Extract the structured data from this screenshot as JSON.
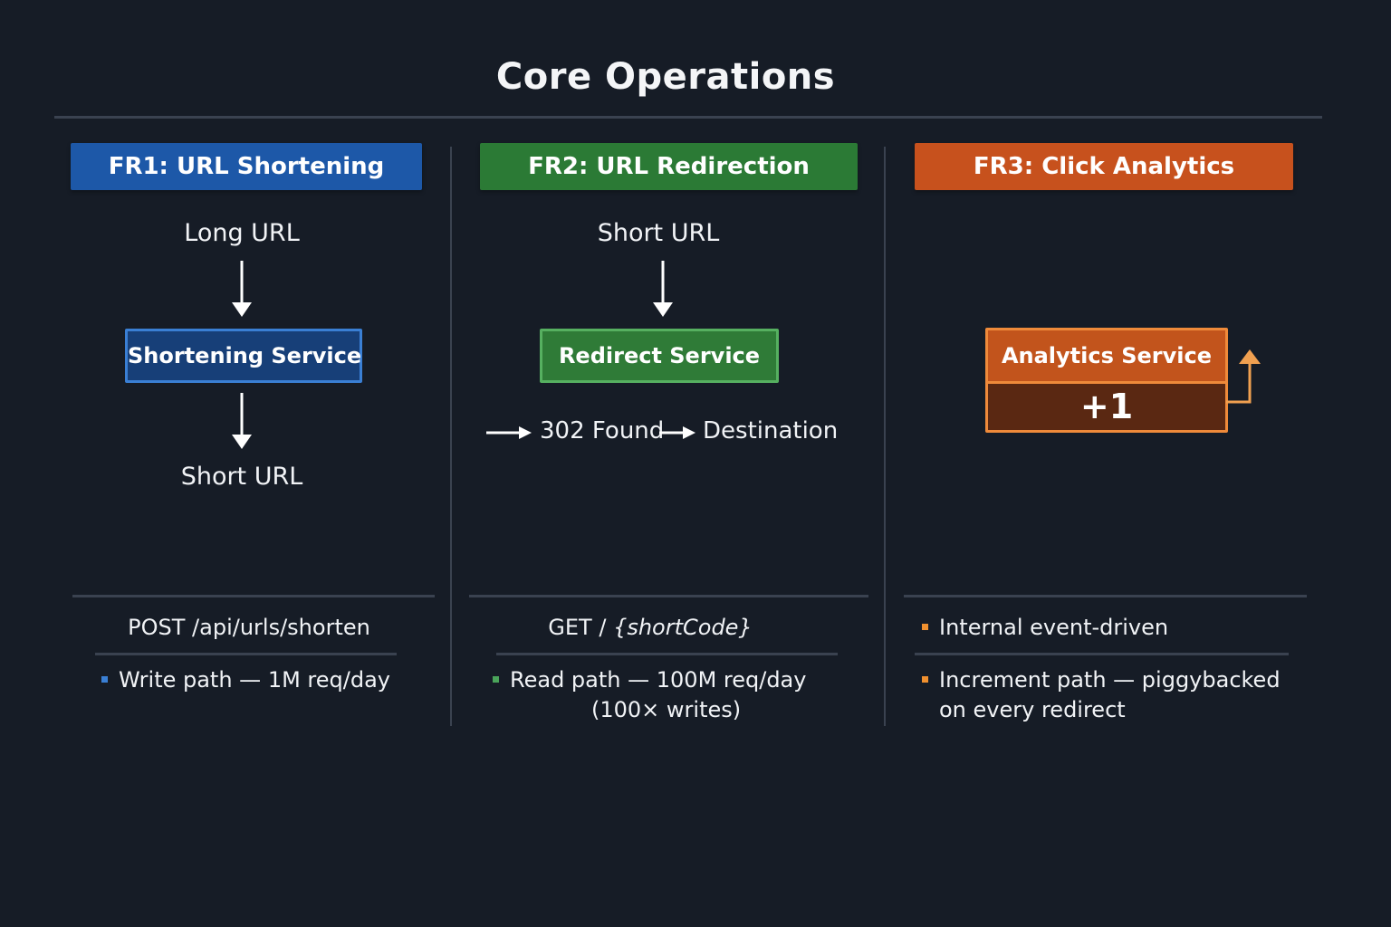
{
  "title": "Core Operations",
  "colors": {
    "background": "#161c26",
    "fr1": "#1d58a8",
    "fr2": "#2b7a35",
    "fr3": "#c7511d",
    "divider": "#3a4250"
  },
  "columns": {
    "fr1": {
      "header": "FR1: URL Shortening",
      "input": "Long URL",
      "service": "Shortening Service",
      "output": "Short URL",
      "endpoint": "POST /api/urls/shorten",
      "bullets": [
        "Write path — 1M req/day"
      ]
    },
    "fr2": {
      "header": "FR2: URL Redirection",
      "input": "Short URL",
      "service": "Redirect Service",
      "status": "302 Found",
      "destination": "Destination",
      "endpoint_method": "GET /",
      "endpoint_param": "{shortCode}",
      "bullets": [
        "Read path — 100M req/day",
        "(100× writes)"
      ]
    },
    "fr3": {
      "header": "FR3: Click Analytics",
      "service": "Analytics Service",
      "counter": "+1",
      "bullets": [
        "Internal event-driven",
        "Increment path — piggybacked",
        "on every redirect"
      ]
    }
  }
}
